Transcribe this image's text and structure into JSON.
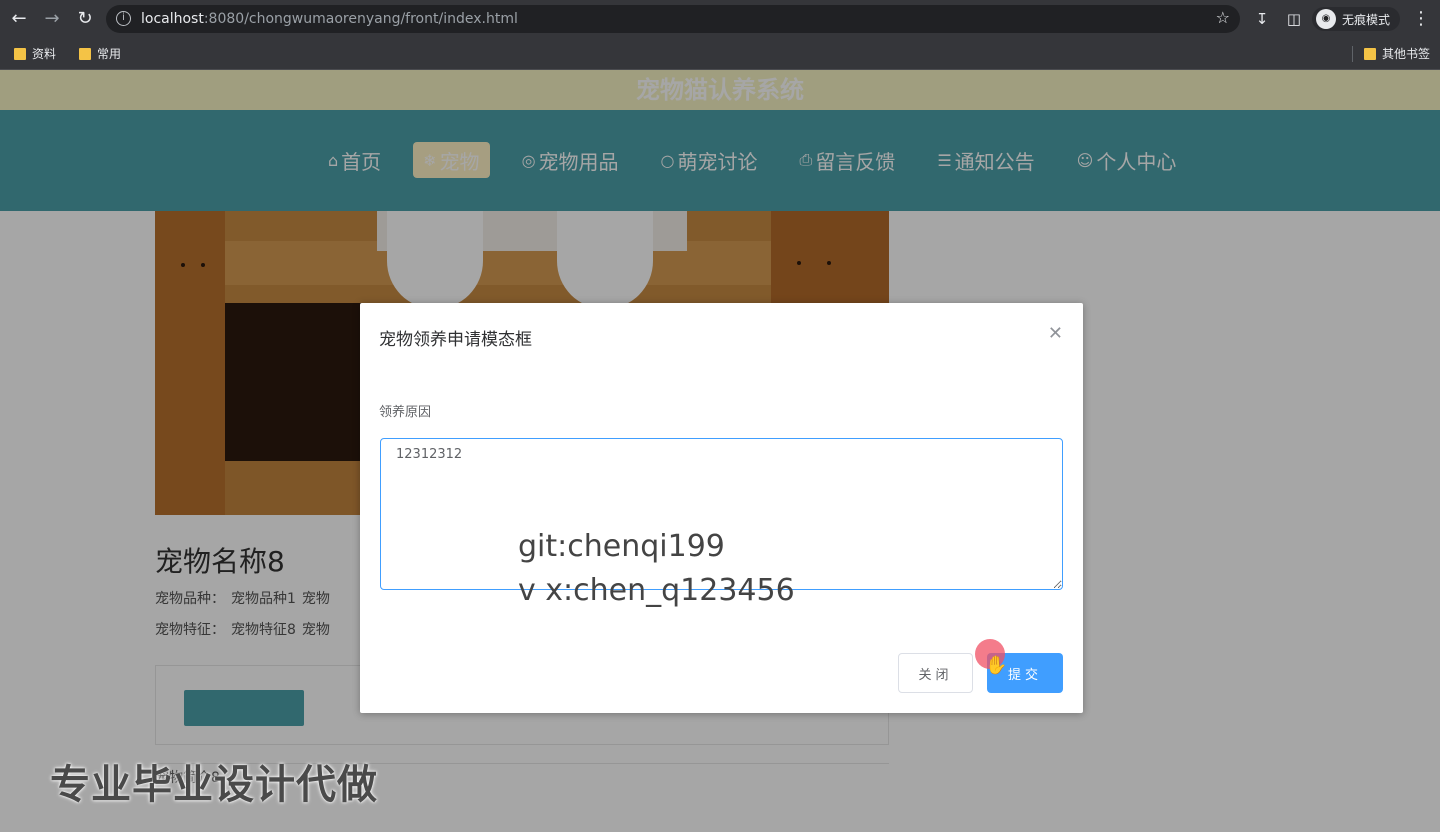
{
  "browser": {
    "url_host": "localhost",
    "url_rest": ":8080/chongwumaorenyang/front/index.html",
    "incognito_label": "无痕模式",
    "bookmarks": [
      "资料",
      "常用"
    ],
    "other_bookmarks": "其他书签"
  },
  "site": {
    "title": "宠物猫认养系统",
    "nav": [
      {
        "icon": "home-icon",
        "label": "首页",
        "active": false
      },
      {
        "icon": "snowflake-icon",
        "label": "宠物",
        "active": true
      },
      {
        "icon": "globe-icon",
        "label": "宠物用品",
        "active": false
      },
      {
        "icon": "chat-icon",
        "label": "萌宠讨论",
        "active": false
      },
      {
        "icon": "printer-icon",
        "label": "留言反馈",
        "active": false
      },
      {
        "icon": "layers-icon",
        "label": "通知公告",
        "active": false
      },
      {
        "icon": "user-icon",
        "label": "个人中心",
        "active": false
      }
    ]
  },
  "pet": {
    "name": "宠物名称8",
    "row1": [
      "宠物品种：",
      "宠物品种1",
      "宠物"
    ],
    "row2": [
      "宠物特征：",
      "宠物特征8",
      "宠物"
    ],
    "intro": "宠物简介8"
  },
  "modal": {
    "title": "宠物领养申请模态框",
    "field_label": "领养原因",
    "reason_value": "12312312",
    "close_label": "关闭",
    "submit_label": "提交"
  },
  "watermark": {
    "git_line": "git:chenqi199",
    "vx_line": "v x:chen_q123456",
    "promo": "专业毕业设计代做"
  }
}
